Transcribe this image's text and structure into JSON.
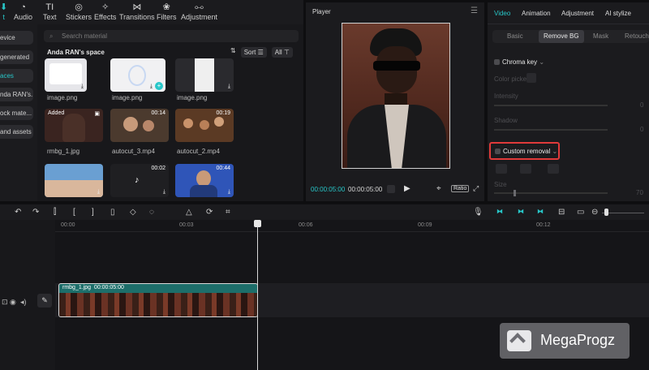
{
  "toolbar": {
    "items": [
      {
        "label": "t",
        "icon": "import-icon"
      },
      {
        "label": "Audio",
        "icon": "audio-icon"
      },
      {
        "label": "Text",
        "icon": "text-icon"
      },
      {
        "label": "Stickers",
        "icon": "stickers-icon"
      },
      {
        "label": "Effects",
        "icon": "effects-icon"
      },
      {
        "label": "Transitions",
        "icon": "transitions-icon"
      },
      {
        "label": "Filters",
        "icon": "filters-icon"
      },
      {
        "label": "Adjustment",
        "icon": "adjustment-icon"
      }
    ]
  },
  "leftnav": {
    "items": [
      "evice",
      "generated",
      "aces",
      "nda RAN's...",
      "ock mate...",
      "and assets"
    ]
  },
  "media": {
    "search_placeholder": "Search material",
    "space_title": "Anda RAN's space",
    "sort_label": "Sort",
    "all_label": "All",
    "items": [
      {
        "name": "image.png",
        "badge": "",
        "duration": ""
      },
      {
        "name": "image.png",
        "badge": "",
        "duration": ""
      },
      {
        "name": "image.png",
        "badge": "",
        "duration": ""
      },
      {
        "name": "rmbg_1.jpg",
        "badge": "Added",
        "duration": ""
      },
      {
        "name": "autocut_3.mp4",
        "badge": "",
        "duration": "00:14"
      },
      {
        "name": "autocut_2.mp4",
        "badge": "",
        "duration": "00:19"
      },
      {
        "name": "",
        "badge": "",
        "duration": ""
      },
      {
        "name": "",
        "badge": "",
        "duration": "00:02"
      },
      {
        "name": "",
        "badge": "",
        "duration": "00:44"
      }
    ]
  },
  "player": {
    "title": "Player",
    "current_time": "00:00:05:00",
    "total_time": "00:00:05:00",
    "ratio_label": "Ratio"
  },
  "props": {
    "tabs": [
      "Video",
      "Animation",
      "Adjustment",
      "AI stylize"
    ],
    "subtabs": [
      "Basic",
      "Remove BG",
      "Mask",
      "Retouch"
    ],
    "chroma_key": "Chroma key",
    "color_picker": "Color picker",
    "intensity": "Intensity",
    "shadow": "Shadow",
    "intensity_value": "0",
    "shadow_value": "0",
    "custom_removal": "Custom removal",
    "size": "Size",
    "size_value": "70",
    "highlight_color": "#e03a3a"
  },
  "timeline": {
    "ruler": [
      "00:00",
      "00:03",
      "00:06",
      "00:09",
      "00:12"
    ],
    "clip_name": "rmbg_1.jpg",
    "clip_duration": "00:00:05:00"
  },
  "watermark": {
    "text": "MegaProgz"
  },
  "colors": {
    "accent": "#28c7c9"
  }
}
